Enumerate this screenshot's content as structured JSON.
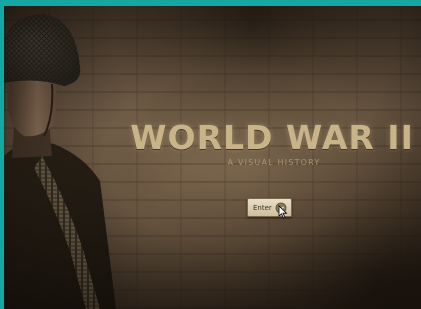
{
  "hero": {
    "title": "WORLD WAR II",
    "subtitle": "A VISUAL HISTORY"
  },
  "enter_button": {
    "label": "Enter",
    "icon": "chevron-down-circle-icon"
  },
  "colors": {
    "frame": "#15a8a2",
    "title": "#c9b48a",
    "subtitle": "#a99473",
    "button_bg": "#e9dfc8"
  }
}
